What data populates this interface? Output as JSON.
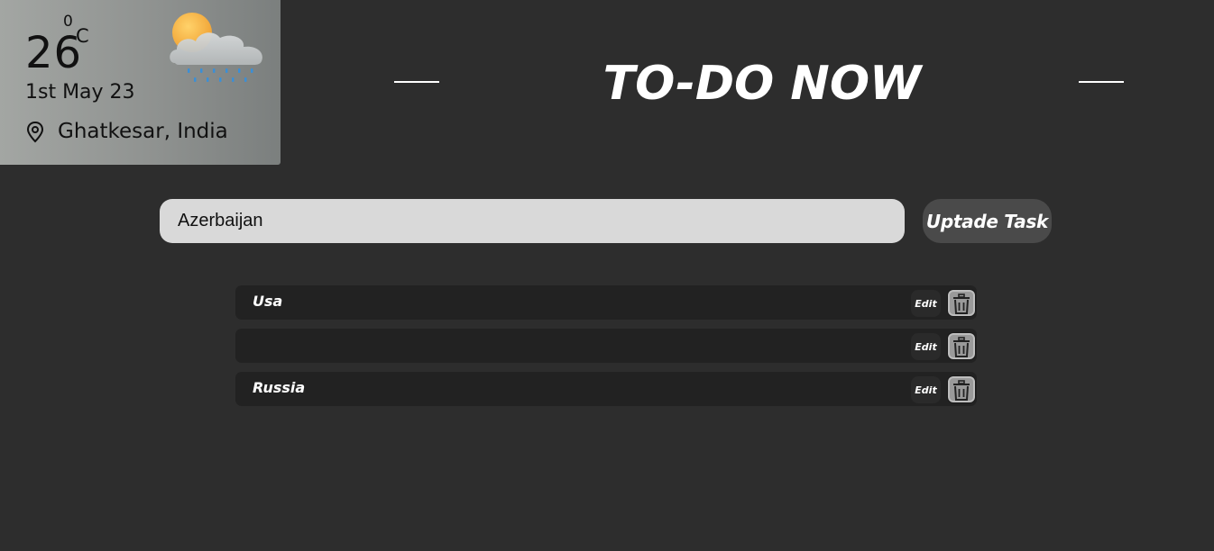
{
  "weather": {
    "temperature": "26",
    "degree_symbol": "0",
    "unit": "C",
    "date": "1st May 23",
    "location": "Ghatkesar, India",
    "location_icon": "map-pin-icon",
    "condition_icon": "partly-cloudy-rain-icon"
  },
  "header": {
    "title": "TO-DO NOW"
  },
  "task_input": {
    "value": "Azerbaijan",
    "placeholder": ""
  },
  "update_button": {
    "label": "Uptade Task"
  },
  "tasks": [
    {
      "text": "Usa",
      "edit_label": "Edit",
      "delete_icon": "trash-icon"
    },
    {
      "text": "",
      "edit_label": "Edit",
      "delete_icon": "trash-icon"
    },
    {
      "text": "Russia",
      "edit_label": "Edit",
      "delete_icon": "trash-icon"
    }
  ],
  "colors": {
    "background": "#2d2d2d",
    "input_background": "#d9d9d9",
    "task_row": "#222222",
    "button": "#4a4a4a",
    "text": "#ffffff"
  }
}
